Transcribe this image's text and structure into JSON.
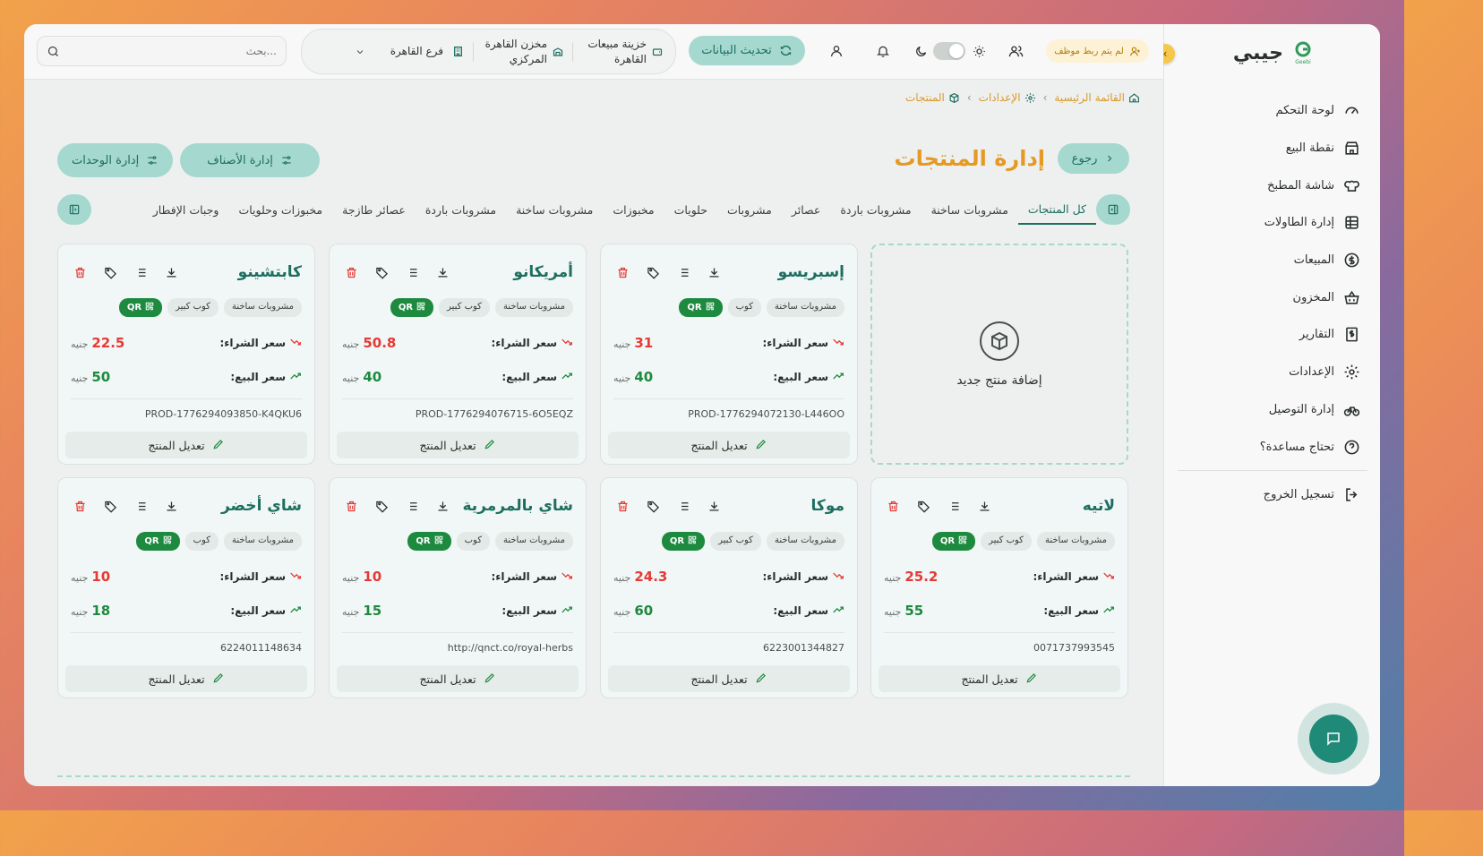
{
  "sidebar": {
    "brand": "جيبي",
    "logo_text": "Geebi",
    "items": [
      {
        "label": "لوحة التحكم",
        "icon": "gauge-icon"
      },
      {
        "label": "نقطة البيع",
        "icon": "store-icon"
      },
      {
        "label": "شاشة المطبخ",
        "icon": "chef-hat-icon"
      },
      {
        "label": "إدارة الطاولات",
        "icon": "table-grid-icon"
      },
      {
        "label": "المبيعات",
        "icon": "dollar-circle-icon"
      },
      {
        "label": "المخزون",
        "icon": "basket-icon"
      },
      {
        "label": "التقارير",
        "icon": "report-icon"
      },
      {
        "label": "الإعدادات",
        "icon": "gear-icon"
      },
      {
        "label": "إدارة التوصيل",
        "icon": "bike-icon"
      },
      {
        "label": "تحتاج مساعدة؟",
        "icon": "help-circle-icon"
      }
    ],
    "logout": "تسجيل الخروج"
  },
  "header": {
    "search_placeholder": "بحث...",
    "unlinked_employee": "لم يتم ربط موظف",
    "refresh": "تحديث البيانات",
    "branch": "فرع القاهرة",
    "warehouse": "مخزن القاهرة المركزي",
    "cashbox": "خزينة مبيعات القاهرة"
  },
  "breadcrumb": [
    "القائمة الرئيسية",
    "الإعدادات",
    "المنتجات"
  ],
  "page": {
    "title": "إدارة المنتجات",
    "back": "رجوع",
    "manage_categories": "إدارة الأصناف",
    "manage_units": "إدارة الوحدات"
  },
  "tabs": [
    "كل المنتجات",
    "مشروبات ساخنة",
    "مشروبات باردة",
    "عصائر",
    "مشروبات",
    "حلويات",
    "مخبوزات",
    "مشروبات ساخنة",
    "مشروبات باردة",
    "عصائر طازجة",
    "مخبوزات وحلويات",
    "وجبات الإفطار"
  ],
  "labels": {
    "add_product": "إضافة منتج جديد",
    "buy_price": "سعر الشراء:",
    "sell_price": "سعر البيع:",
    "currency": "جنيه",
    "edit": "تعديل المنتج",
    "qr": "QR"
  },
  "products": [
    {
      "name": "إسبريسو",
      "category": "مشروبات ساخنة",
      "unit": "كوب",
      "buy": "31",
      "sell": "40",
      "code": "PROD-1776294072130-L446OO"
    },
    {
      "name": "أمريكانو",
      "category": "مشروبات ساخنة",
      "unit": "كوب كبير",
      "buy": "50.8",
      "sell": "40",
      "code": "PROD-1776294076715-6O5EQZ"
    },
    {
      "name": "كابتشينو",
      "category": "مشروبات ساخنة",
      "unit": "كوب كبير",
      "buy": "22.5",
      "sell": "50",
      "code": "PROD-1776294093850-K4QKU6"
    },
    {
      "name": "لاتيه",
      "category": "مشروبات ساخنة",
      "unit": "كوب كبير",
      "buy": "25.2",
      "sell": "55",
      "code": "0071737993545"
    },
    {
      "name": "موكا",
      "category": "مشروبات ساخنة",
      "unit": "كوب كبير",
      "buy": "24.3",
      "sell": "60",
      "code": "6223001344827"
    },
    {
      "name": "شاي بالمرمرية",
      "category": "مشروبات ساخنة",
      "unit": "كوب",
      "buy": "10",
      "sell": "15",
      "code": "http://qnct.co/royal-herbs"
    },
    {
      "name": "شاي أخضر",
      "category": "مشروبات ساخنة",
      "unit": "كوب",
      "buy": "10",
      "sell": "18",
      "code": "6224011148634"
    }
  ]
}
